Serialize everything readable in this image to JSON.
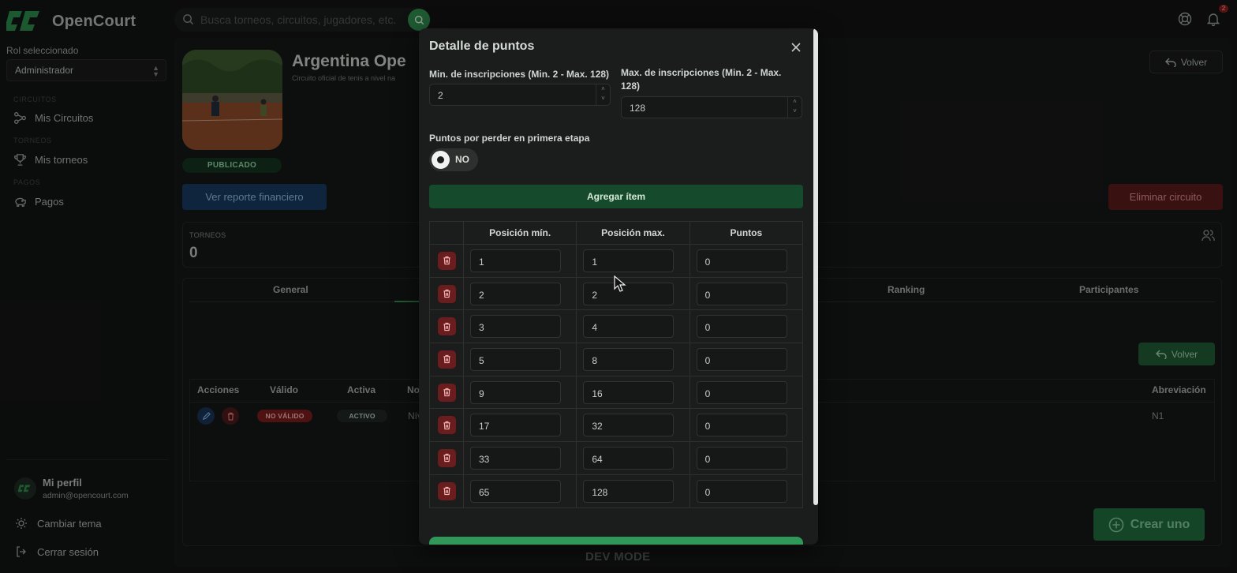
{
  "app": {
    "name": "OpenCourt"
  },
  "search": {
    "placeholder": "Busca torneos, circuitos, jugadores, etc."
  },
  "notifications": {
    "count": "2"
  },
  "sidebar": {
    "role_label": "Rol seleccionado",
    "role_value": "Administrador",
    "sections": [
      {
        "label": "CIRCUITOS",
        "item": "Mis Circuitos"
      },
      {
        "label": "TORNEOS",
        "item": "Mis torneos"
      },
      {
        "label": "PAGOS",
        "item": "Pagos"
      }
    ],
    "profile": {
      "name": "Mi perfil",
      "email": "admin@opencourt.com"
    },
    "theme_label": "Cambiar tema",
    "logout_label": "Cerrar sesión"
  },
  "circuit": {
    "title": "Argentina Ope",
    "subtitle": "Circuito oficial de tenis a nivel na",
    "status": "PUBLICADO",
    "back_label": "Volver",
    "report_label": "Ver reporte financiero",
    "delete_label": "Eliminar circuito",
    "stat_label": "TORNEOS",
    "stat_value": "0"
  },
  "tabs": [
    "General",
    "Ranking",
    "Participantes"
  ],
  "levels_table": {
    "back_label": "Volver",
    "headers": {
      "acciones": "Acciones",
      "valido": "Válido",
      "activa": "Activa",
      "nombre": "No",
      "abreviacion": "Abreviación"
    },
    "row": {
      "valido": "NO VÁLIDO",
      "activa": "ACTIVO",
      "nombre": "Nív",
      "abreviacion": "N1"
    }
  },
  "create_label": "Crear uno",
  "dev_mode": "DEV MODE",
  "modal": {
    "title": "Detalle de puntos",
    "min_label": "Min. de inscripciones (Min. 2 - Max. 128)",
    "min_value": "2",
    "max_label": "Max. de inscripciones (Min. 2 - Max. 128)",
    "max_value": "128",
    "lose_label": "Puntos por perder en primera etapa",
    "lose_toggle": "NO",
    "add_label": "Agregar ítem",
    "columns": [
      "Posición mín.",
      "Posición max.",
      "Puntos"
    ],
    "rows": [
      {
        "min": "1",
        "max": "1",
        "pts": "0"
      },
      {
        "min": "2",
        "max": "2",
        "pts": "0"
      },
      {
        "min": "3",
        "max": "4",
        "pts": "0"
      },
      {
        "min": "5",
        "max": "8",
        "pts": "0"
      },
      {
        "min": "9",
        "max": "16",
        "pts": "0"
      },
      {
        "min": "17",
        "max": "32",
        "pts": "0"
      },
      {
        "min": "33",
        "max": "64",
        "pts": "0"
      },
      {
        "min": "65",
        "max": "128",
        "pts": "0"
      }
    ]
  },
  "colors": {
    "accent_green": "#2f9858",
    "danger_red": "#6b1d1d",
    "info_blue": "#173a60"
  }
}
